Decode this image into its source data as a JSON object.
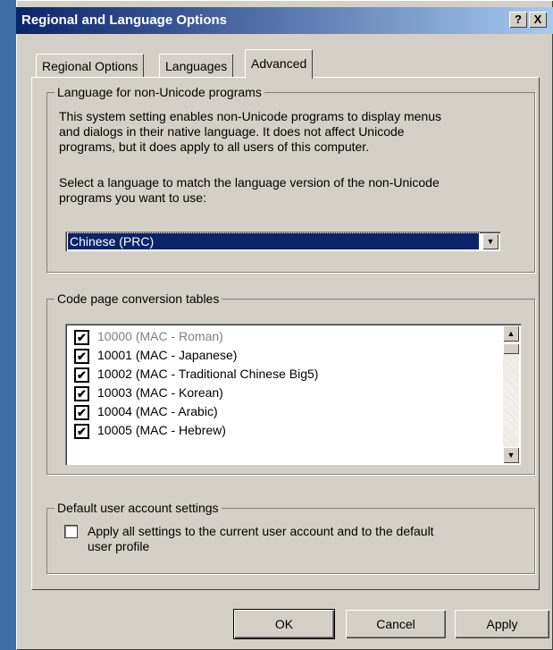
{
  "window": {
    "title": "Regional and Language Options",
    "help_button": "?",
    "close_button": "X"
  },
  "tabs": [
    {
      "label": "Regional Options",
      "active": false
    },
    {
      "label": "Languages",
      "active": false
    },
    {
      "label": "Advanced",
      "active": true
    }
  ],
  "nonunicode": {
    "legend": "Language for non-Unicode programs",
    "desc_lines": [
      "This system setting enables non-Unicode programs to display menus",
      "and dialogs in their native language. It does not affect Unicode",
      "programs, but it does apply to all users of this computer."
    ],
    "select_lines": [
      "Select a language to match the language version of the non-Unicode",
      "programs you want to use:"
    ],
    "selected_language": "Chinese (PRC)"
  },
  "codepages": {
    "legend": "Code page conversion tables",
    "items": [
      {
        "label": "10000 (MAC - Roman)",
        "checked": true,
        "disabled": true
      },
      {
        "label": "10001 (MAC - Japanese)",
        "checked": true,
        "disabled": false
      },
      {
        "label": "10002 (MAC - Traditional Chinese Big5)",
        "checked": true,
        "disabled": false
      },
      {
        "label": "10003 (MAC - Korean)",
        "checked": true,
        "disabled": false
      },
      {
        "label": "10004 (MAC - Arabic)",
        "checked": true,
        "disabled": false
      },
      {
        "label": "10005 (MAC - Hebrew)",
        "checked": true,
        "disabled": false
      }
    ]
  },
  "defaults": {
    "legend": "Default user account settings",
    "checkbox_lines": [
      "Apply all settings to the current user account and to the default",
      "user profile"
    ],
    "checked": false
  },
  "buttons": {
    "ok": "OK",
    "cancel": "Cancel",
    "apply": "Apply"
  },
  "glyphs": {
    "check": "✔",
    "arrow_down": "▼",
    "arrow_up": "▲"
  }
}
